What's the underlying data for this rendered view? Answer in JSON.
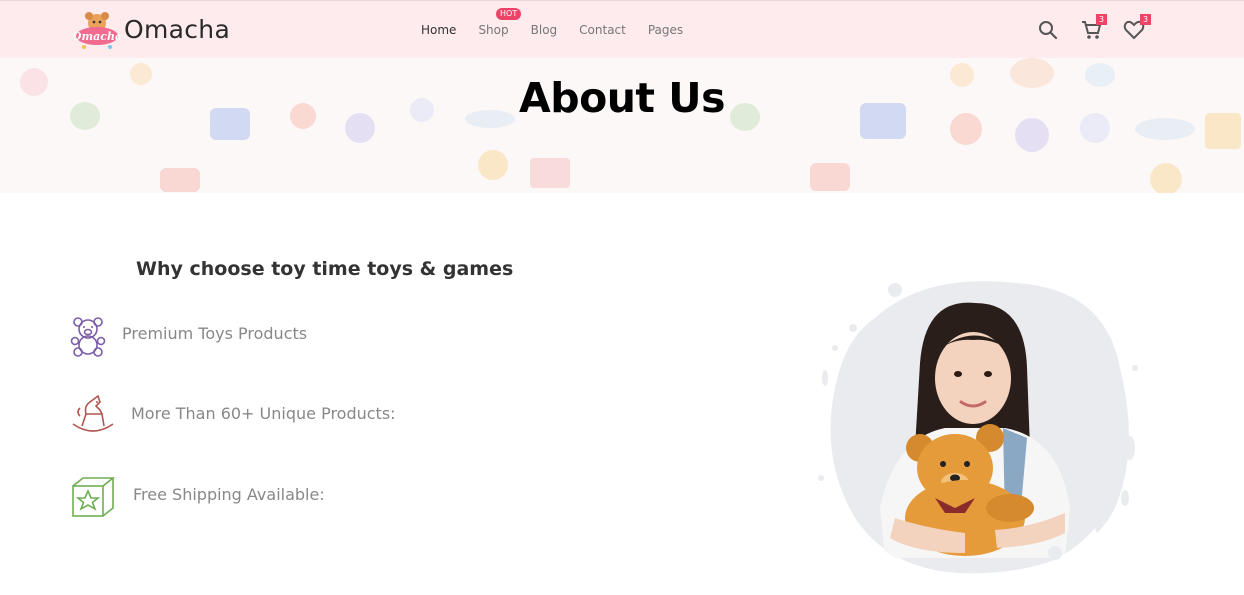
{
  "header": {
    "brand": "Omacha",
    "nav": [
      {
        "label": "Home"
      },
      {
        "label": "Shop"
      },
      {
        "label": "Blog"
      },
      {
        "label": "Contact"
      },
      {
        "label": "Pages"
      }
    ],
    "hot_badge": "HOT",
    "cart_count": "3",
    "wishlist_count": "3"
  },
  "hero": {
    "title": "About Us"
  },
  "section": {
    "heading": "Why choose toy time toys & games",
    "features": [
      {
        "label": "Premium Toys Products",
        "icon": "teddy-bear-icon"
      },
      {
        "label": "More Than 60+ Unique Products:",
        "icon": "rocking-horse-icon"
      },
      {
        "label": "Free Shipping Available:",
        "icon": "star-box-icon"
      }
    ]
  },
  "colors": {
    "header_bg": "#fdebee",
    "accent": "#ee4266"
  }
}
